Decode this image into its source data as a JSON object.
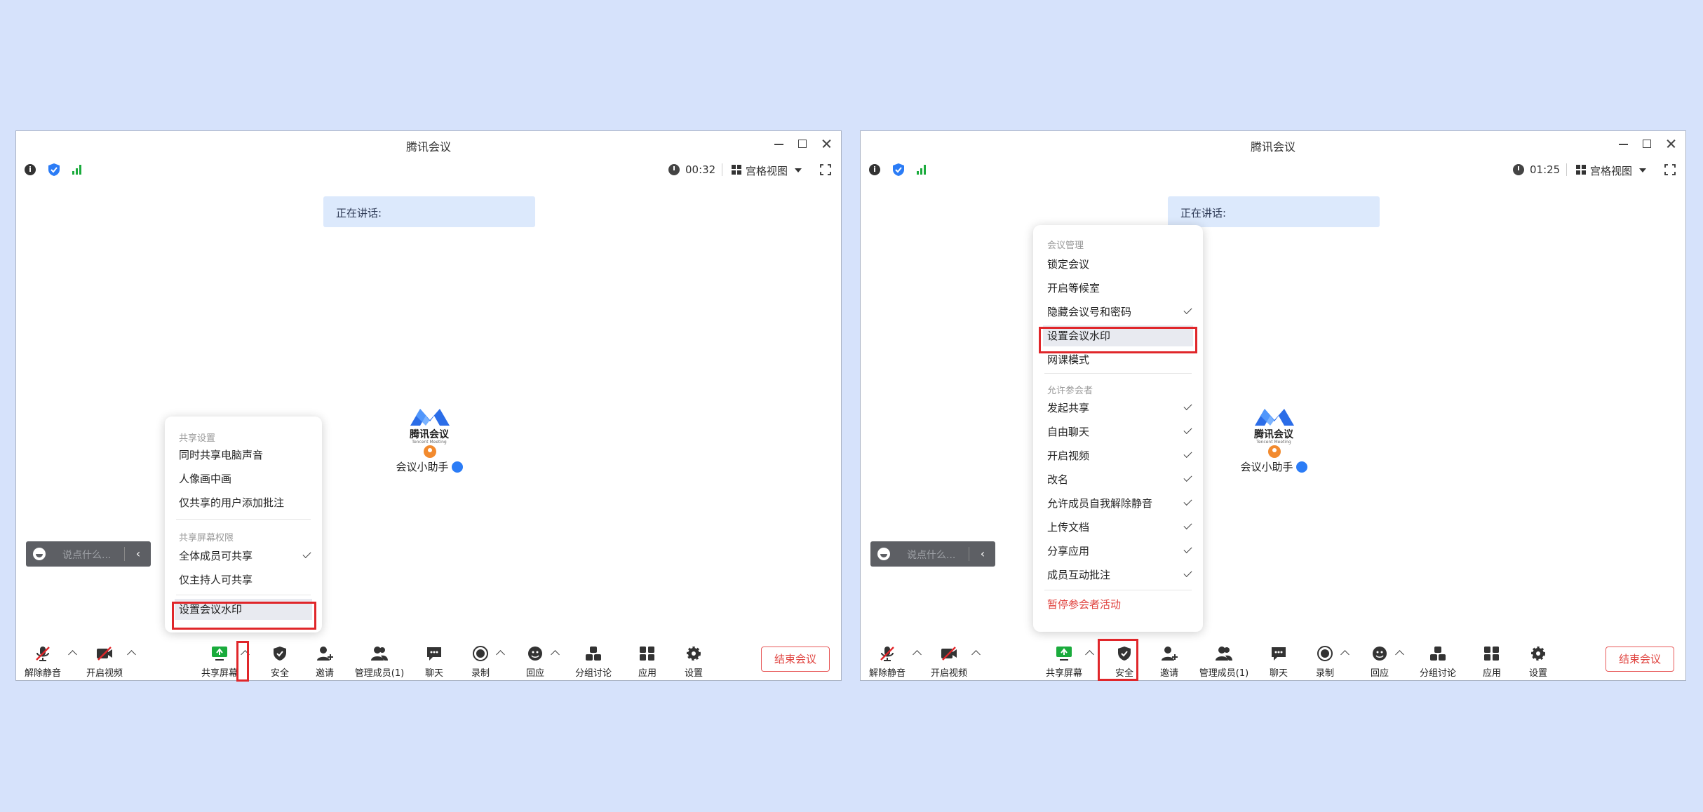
{
  "app_title": "腾讯会议",
  "left": {
    "timer": "00:32",
    "view_label": "宫格视图",
    "speaking_label": "正在讲话:",
    "brand": "腾讯会议",
    "brand_en": "Tencent Meeting",
    "assistant": "会议小助手",
    "chat_placeholder": "说点什么...",
    "end_button": "结束会议",
    "share_menu": {
      "section1": "共享设置",
      "items1": [
        "同时共享电脑声音",
        "人像画中画",
        "仅共享的用户添加批注"
      ],
      "section2": "共享屏幕权限",
      "items2": [
        "全体成员可共享",
        "仅主持人可共享"
      ],
      "items2_checked": [
        true,
        false
      ],
      "watermark": "设置会议水印"
    }
  },
  "right": {
    "timer": "01:25",
    "view_label": "宫格视图",
    "speaking_label": "正在讲话:",
    "brand": "腾讯会议",
    "brand_en": "Tencent Meeting",
    "assistant": "会议小助手",
    "chat_placeholder": "说点什么...",
    "end_button": "结束会议",
    "security_menu": {
      "section1": "会议管理",
      "items1": [
        "锁定会议",
        "开启等候室",
        "隐藏会议号和密码"
      ],
      "items1_checked": [
        false,
        false,
        true
      ],
      "watermark": "设置会议水印",
      "classroom": "网课模式",
      "section2": "允许参会者",
      "items2": [
        "发起共享",
        "自由聊天",
        "开启视频",
        "改名",
        "允许成员自我解除静音",
        "上传文档",
        "分享应用",
        "成员互动批注"
      ],
      "items2_checked": [
        true,
        true,
        true,
        true,
        true,
        true,
        true,
        true
      ],
      "pause": "暂停参会者活动"
    }
  },
  "toolbar": {
    "unmute": "解除静音",
    "video": "开启视频",
    "share": "共享屏幕",
    "security": "安全",
    "invite": "邀请",
    "members": "管理成员(1)",
    "chat": "聊天",
    "record": "录制",
    "react": "回应",
    "breakout": "分组讨论",
    "apps": "应用",
    "settings": "设置"
  },
  "colors": {
    "background": "#d6e2fb",
    "accent": "#2b7cf6",
    "danger": "#e0433f",
    "highlight_box": "#e0262a",
    "share_icon": "#1aab3c"
  }
}
